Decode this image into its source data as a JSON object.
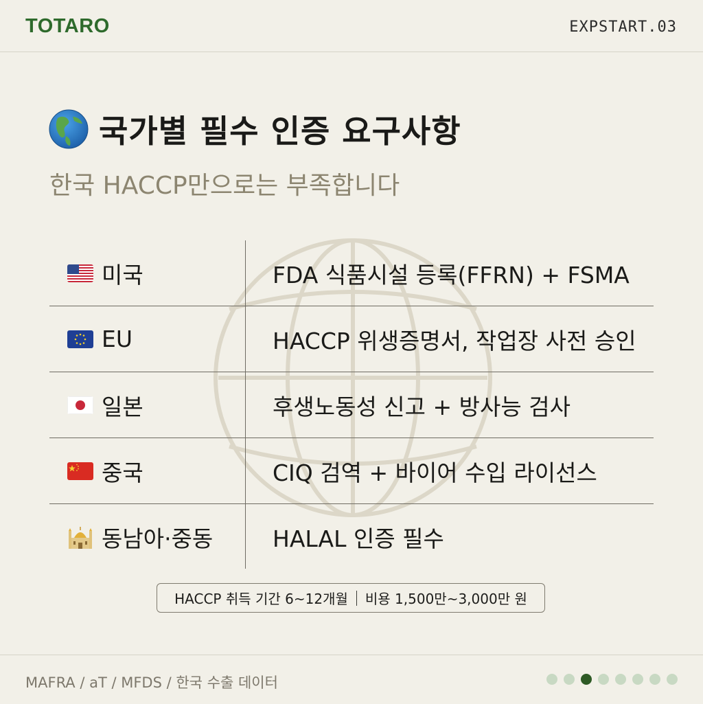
{
  "header": {
    "brand": "TOTARO",
    "code": "EXPSTART.03"
  },
  "main": {
    "title": "국가별 필수 인증 요구사항",
    "subtitle": "한국 HACCP만으로는 부족합니다",
    "rows": [
      {
        "country": "미국",
        "flag_icon": "us-flag-icon",
        "requirement": "FDA 식품시설 등록(FFRN) + FSMA"
      },
      {
        "country": "EU",
        "flag_icon": "eu-flag-icon",
        "requirement": "HACCP 위생증명서, 작업장 사전 승인"
      },
      {
        "country": "일본",
        "flag_icon": "japan-flag-icon",
        "requirement": "후생노동성 신고 + 방사능 검사"
      },
      {
        "country": "중국",
        "flag_icon": "china-flag-icon",
        "requirement": "CIQ 검역 + 바이어 수입 라이선스"
      },
      {
        "country": "동남아·중동",
        "flag_icon": "mosque-icon",
        "requirement": "HALAL 인증 필수"
      }
    ],
    "note": {
      "left": "HACCP 취득 기간 6~12개월",
      "right": "비용 1,500만~3,000만 원"
    }
  },
  "footer": {
    "source": "MAFRA / aT / MFDS / 한국 수출 데이터",
    "page_dots": 8,
    "active_dot": 3
  },
  "colors": {
    "background": "#f2f0e8",
    "brand": "#2e6a2c",
    "subtitle": "#8c8570",
    "dot_inactive": "#c8d9c3",
    "dot_active": "#2e5a25"
  }
}
